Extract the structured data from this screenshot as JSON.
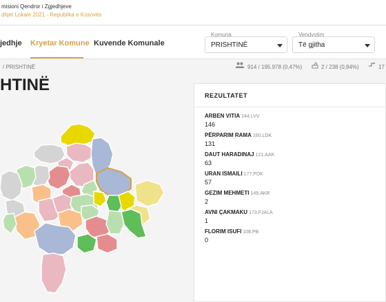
{
  "header": {
    "org_name": "misioni Qendror i Zgjedhjeve",
    "org_subtitle": "dhjet Lokale 2021 - Republika e Kosovës"
  },
  "nav": {
    "tabs": [
      {
        "label": "jedhje",
        "active": false
      },
      {
        "label": "Kryetar Komune",
        "active": true
      },
      {
        "label": "Kuvende Komunale",
        "active": false
      }
    ],
    "accent_color": "#d4a24a"
  },
  "filters": {
    "komuna": {
      "label": "Komuna",
      "value": "PRISHTINË"
    },
    "vendvotim": {
      "label": "Vendvotim",
      "value": "Të gjitha"
    }
  },
  "breadcrumb": "/ PRISHTINË",
  "stats": {
    "voters": "914 / 195.978 (0,47%)",
    "stations": "2 / 238 (0,84%)",
    "other": "17"
  },
  "page_title": "HTINË",
  "results": {
    "heading": "REZULTATET",
    "candidates": [
      {
        "name": "ARBEN VITIA",
        "party": "144.LVV",
        "votes": "146"
      },
      {
        "name": "PËRPARIM RAMA",
        "party": "160.LDK",
        "votes": "131"
      },
      {
        "name": "DAUT HARADINAJ",
        "party": "121.AAK",
        "votes": "63"
      },
      {
        "name": "URAN ISMAILI",
        "party": "177.PDK",
        "votes": "57"
      },
      {
        "name": "GEZIM MEHMETI",
        "party": "149.AKR",
        "votes": "2"
      },
      {
        "name": "AVNI ÇAKMAKU",
        "party": "173.FJALA",
        "votes": "1"
      },
      {
        "name": "FLORIM ISUFI",
        "party": "108.PB",
        "votes": "0"
      }
    ]
  },
  "map_colors": {
    "yellow": "#e8d800",
    "pink": "#eab8c0",
    "red": "#e58c8f",
    "blue_grey": "#a8b8d6",
    "orange": "#f9c08a",
    "light_green": "#b9dfb0",
    "green": "#5fbd5a",
    "light_yellow": "#f0e28a",
    "grey": "#d4d4d4"
  }
}
